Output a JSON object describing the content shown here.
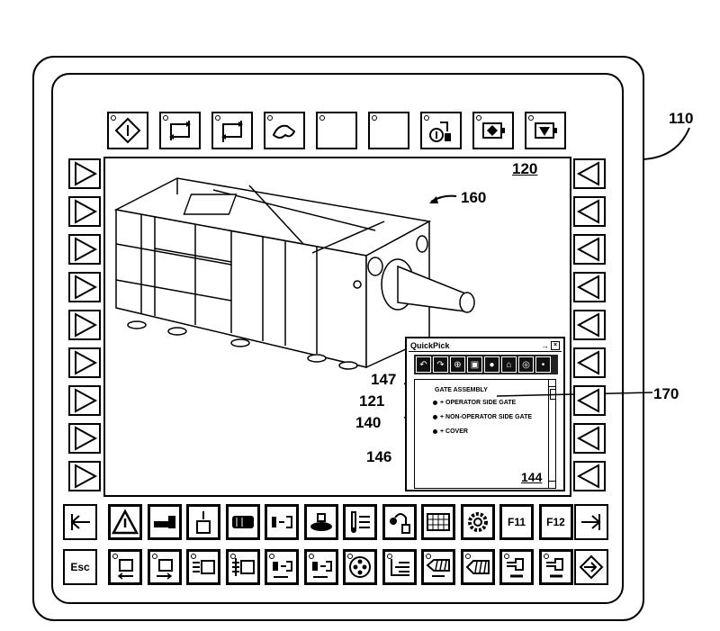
{
  "figure_refs": {
    "device": "110",
    "main_view": "120",
    "machine": "160",
    "leader_147": "147",
    "leader_121": "121",
    "leader_140": "140",
    "leader_146": "146",
    "gate_line": "170",
    "quickpick_panel": "144"
  },
  "top_toolbar": [
    {
      "icon": "diamond-info-icon"
    },
    {
      "icon": "cycle-arrows-icon"
    },
    {
      "icon": "cycle-arrows-alt-icon"
    },
    {
      "icon": "hand-icon"
    },
    {
      "icon": "blank"
    },
    {
      "icon": "blank"
    },
    {
      "icon": "robot-info-icon"
    },
    {
      "icon": "motor-diamond-icon"
    },
    {
      "icon": "motor-triangle-icon"
    }
  ],
  "left_softkeys_count": 9,
  "right_softkeys_count": 9,
  "quickpick": {
    "title": "QuickPick",
    "tools": [
      "undo-icon",
      "redo-icon",
      "target-icon",
      "page-icon",
      "record-icon",
      "home-icon",
      "search-icon",
      "record-dot-icon"
    ],
    "items": [
      {
        "label": "GATE ASSEMBLY",
        "level": 0
      },
      {
        "label": "+ OPERATOR SIDE GATE",
        "level": 1
      },
      {
        "label": "+ NON-OPERATOR SIDE GATE",
        "level": 1
      },
      {
        "label": "+ COVER",
        "level": 1
      }
    ]
  },
  "function_row": [
    {
      "icon": "arrow-left-bar-icon"
    },
    {
      "icon": "warning-icon"
    },
    {
      "icon": "injection-unit-icon"
    },
    {
      "icon": "mold-icon"
    },
    {
      "icon": "barrel-icon"
    },
    {
      "icon": "clamp-icon"
    },
    {
      "icon": "conveyor-icon"
    },
    {
      "icon": "temperature-icon"
    },
    {
      "icon": "robot-arm-icon"
    },
    {
      "icon": "grid-icon"
    },
    {
      "icon": "gear-icon"
    },
    {
      "label": "F11"
    },
    {
      "label": "F12"
    },
    {
      "icon": "arrow-right-bar-icon"
    }
  ],
  "command_row": [
    {
      "label": "Esc"
    },
    {
      "icon": "mold-open-icon"
    },
    {
      "icon": "mold-close-icon"
    },
    {
      "icon": "ejector-forward-icon"
    },
    {
      "icon": "ejector-back-icon"
    },
    {
      "icon": "carriage-back-icon"
    },
    {
      "icon": "carriage-forward-icon"
    },
    {
      "icon": "screw-icon"
    },
    {
      "icon": "nozzle-icon"
    },
    {
      "icon": "screw-back-icon"
    },
    {
      "icon": "screw-rotate-icon"
    },
    {
      "icon": "injection-back-icon"
    },
    {
      "icon": "injection-forward-icon"
    },
    {
      "icon": "enter-icon"
    }
  ]
}
